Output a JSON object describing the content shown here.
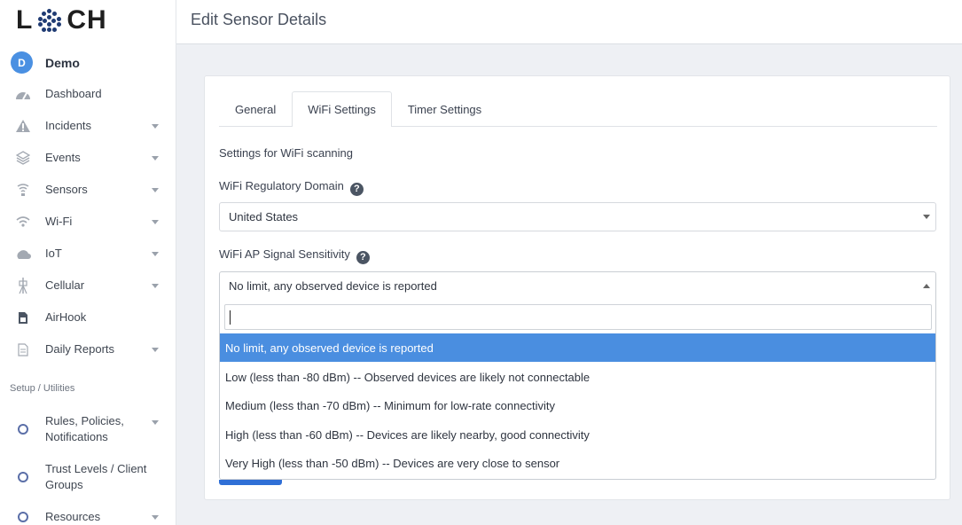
{
  "logo": {
    "letter_l": "L",
    "letters_ch": "CH",
    "dot_color": "#1f3b73"
  },
  "account": {
    "initial": "D",
    "name": "Demo",
    "avatar_color": "#4a90e2"
  },
  "sidebar": {
    "items": [
      {
        "label": "Dashboard",
        "icon": "speedometer-icon",
        "caret": false
      },
      {
        "label": "Incidents",
        "icon": "warning-icon",
        "caret": true
      },
      {
        "label": "Events",
        "icon": "layers-icon",
        "caret": true
      },
      {
        "label": "Sensors",
        "icon": "sensor-icon",
        "caret": true
      },
      {
        "label": "Wi-Fi",
        "icon": "wifi-icon",
        "caret": true
      },
      {
        "label": "IoT",
        "icon": "iot-icon",
        "caret": true
      },
      {
        "label": "Cellular",
        "icon": "cell-tower-icon",
        "caret": true
      },
      {
        "label": "AirHook",
        "icon": "sim-card-icon",
        "caret": false
      },
      {
        "label": "Daily Reports",
        "icon": "document-icon",
        "caret": true
      }
    ],
    "section_label": "Setup / Utilities",
    "setup_items": [
      {
        "line1": "Rules, Policies,",
        "line2": "Notifications",
        "caret": true
      },
      {
        "line1": "Trust Levels / Client",
        "line2": "Groups",
        "caret": false
      },
      {
        "line1": "Resources",
        "line2": "",
        "caret": true
      }
    ]
  },
  "header": {
    "title": "Edit Sensor Details"
  },
  "tabs": [
    {
      "label": "General",
      "active": false
    },
    {
      "label": "WiFi Settings",
      "active": true
    },
    {
      "label": "Timer Settings",
      "active": false
    }
  ],
  "form": {
    "intro": "Settings for WiFi scanning",
    "regulatory_label": "WiFi Regulatory Domain",
    "regulatory_value": "United States",
    "sensitivity_label": "WiFi AP Signal Sensitivity",
    "sensitivity_value": "No limit, any observed device is reported",
    "help_glyph": "?"
  },
  "dropdown": {
    "search_value": "",
    "options": [
      "No limit, any observed device is reported",
      "Low (less than -80 dBm) -- Observed devices are likely not connectable",
      "Medium (less than -70 dBm) -- Minimum for low-rate connectivity",
      "High (less than -60 dBm) -- Devices are likely nearby, good connectivity",
      "Very High (less than -50 dBm) -- Devices are very close to sensor"
    ],
    "selected_index": 0,
    "highlight_color": "#4a8ee0"
  }
}
